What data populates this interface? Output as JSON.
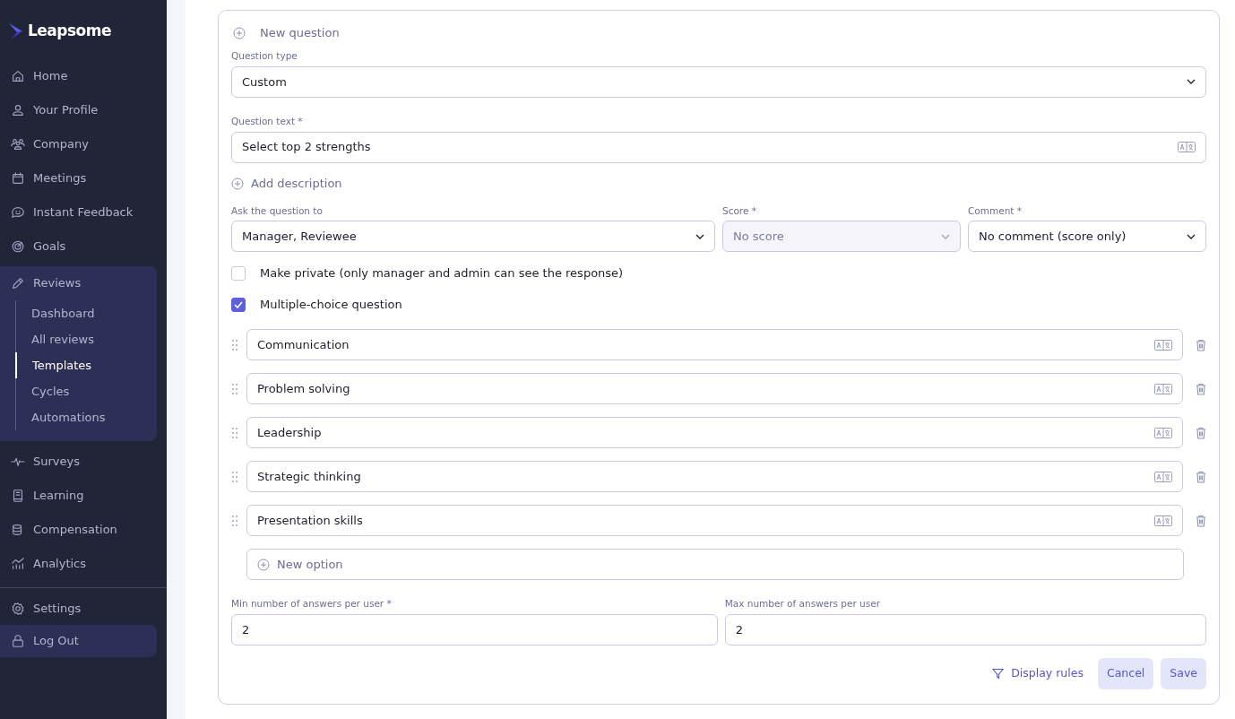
{
  "sidebar": {
    "brand": "Leapsome",
    "items": [
      {
        "label": "Home",
        "highlighted": false
      },
      {
        "label": "Your Profile",
        "highlighted": false
      },
      {
        "label": "Company",
        "highlighted": false
      },
      {
        "label": "Meetings",
        "highlighted": false
      },
      {
        "label": "Instant Feedback",
        "highlighted": false
      },
      {
        "label": "Goals",
        "highlighted": false
      },
      {
        "label": "Reviews",
        "highlighted": true,
        "children": [
          {
            "label": "Dashboard",
            "selected": false
          },
          {
            "label": "All reviews",
            "selected": false
          },
          {
            "label": "Templates",
            "selected": true
          },
          {
            "label": "Cycles",
            "selected": false
          },
          {
            "label": "Automations",
            "selected": false
          }
        ]
      },
      {
        "label": "Surveys",
        "highlighted": false
      },
      {
        "label": "Learning",
        "highlighted": false
      },
      {
        "label": "Compensation",
        "highlighted": false
      },
      {
        "label": "Analytics",
        "highlighted": false
      }
    ],
    "footer_items": [
      {
        "label": "Settings",
        "highlighted": false
      },
      {
        "label": "Log Out",
        "highlighted": true
      }
    ]
  },
  "form": {
    "new_question": "New question",
    "question_type": {
      "label": "Question type",
      "value": "Custom"
    },
    "question_text": {
      "label": "Question text *",
      "value": "Select top 2 strengths"
    },
    "add_description": "Add description",
    "selects": [
      {
        "label": "Ask the question to",
        "value": "Manager, Reviewee",
        "disabled": false
      },
      {
        "label": "Score *",
        "value": "No score",
        "disabled": true
      },
      {
        "label": "Comment *",
        "value": "No comment (score only)",
        "disabled": false
      }
    ],
    "checkboxes": [
      {
        "label": "Make private (only manager and admin can see the response)",
        "checked": false
      },
      {
        "label": "Multiple-choice question",
        "checked": true
      }
    ],
    "options": [
      {
        "value": "Communication"
      },
      {
        "value": "Problem solving"
      },
      {
        "value": "Leadership"
      },
      {
        "value": "Strategic thinking"
      },
      {
        "value": "Presentation skills"
      }
    ],
    "new_option": "New option",
    "answer_limits": [
      {
        "label": "Min number of answers per user *",
        "value": "2"
      },
      {
        "label": "Max number of answers per user",
        "value": "2"
      }
    ],
    "display_rules": "Display rules",
    "buttons": [
      "Cancel",
      "Save"
    ]
  }
}
